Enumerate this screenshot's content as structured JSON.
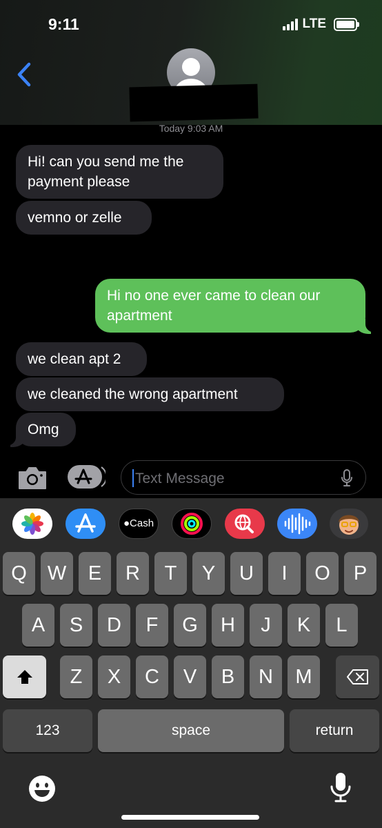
{
  "status_bar": {
    "time": "9:11",
    "network": "LTE"
  },
  "header": {
    "contact_name": ""
  },
  "conversation": {
    "timestamp": "Today 9:03 AM",
    "messages": [
      {
        "from": "them",
        "lines": [
          "Hi! can you send me the",
          "payment please"
        ]
      },
      {
        "from": "them",
        "lines": [
          "vemno or zelle"
        ]
      },
      {
        "from": "them",
        "lines": [
          ""
        ],
        "redacted": true
      },
      {
        "from": "me",
        "lines": [
          "Hi no one ever came to clean our",
          "apartment"
        ]
      },
      {
        "from": "them",
        "lines": [
          "we clean apt 2"
        ]
      },
      {
        "from": "them",
        "lines": [
          "we cleaned the wrong apartment"
        ]
      },
      {
        "from": "them",
        "lines": [
          "Omg"
        ]
      }
    ]
  },
  "input_bar": {
    "placeholder": "Text Message",
    "value": ""
  },
  "app_strip": [
    {
      "name": "photos-app",
      "icon": "photos-flower-icon"
    },
    {
      "name": "app-store-app",
      "icon": "app-store-icon"
    },
    {
      "name": "cash-app",
      "label": "Cash",
      "icon": "apple-cash-icon"
    },
    {
      "name": "fitness-app",
      "icon": "activity-rings-icon"
    },
    {
      "name": "images-search-app",
      "icon": "globe-search-icon"
    },
    {
      "name": "audio-message-app",
      "icon": "waveform-icon"
    },
    {
      "name": "memoji-app",
      "icon": "memoji-icon"
    }
  ],
  "keyboard": {
    "row1": [
      "Q",
      "W",
      "E",
      "R",
      "T",
      "Y",
      "U",
      "I",
      "O",
      "P"
    ],
    "row2": [
      "A",
      "S",
      "D",
      "F",
      "G",
      "H",
      "J",
      "K",
      "L"
    ],
    "row3": [
      "Z",
      "X",
      "C",
      "V",
      "B",
      "N",
      "M"
    ],
    "numbers_label": "123",
    "space_label": "space",
    "return_label": "return"
  },
  "colors": {
    "incoming_bubble": "#26252a",
    "outgoing_bubble": "#5ec05a",
    "accent": "#3b82f6",
    "keyboard_bg": "#2b2b2b",
    "key": "#6b6b6b"
  }
}
